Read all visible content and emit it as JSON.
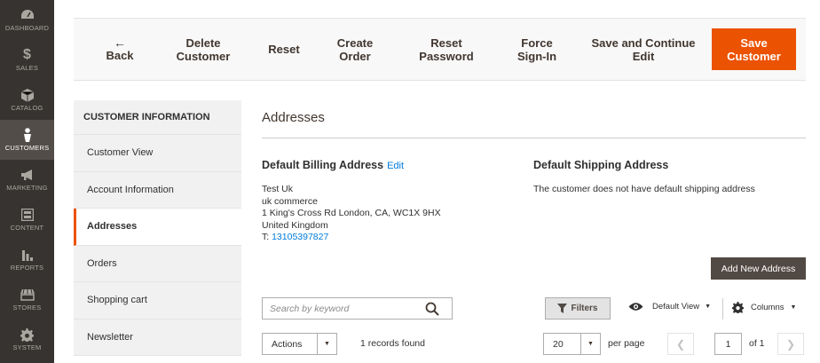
{
  "admin_menu": {
    "items": [
      {
        "label": "DASHBOARD",
        "icon": "dashboard-icon",
        "active": false
      },
      {
        "label": "SALES",
        "icon": "dollar-icon",
        "active": false
      },
      {
        "label": "CATALOG",
        "icon": "cube-icon",
        "active": false
      },
      {
        "label": "CUSTOMERS",
        "icon": "person-icon",
        "active": true
      },
      {
        "label": "MARKETING",
        "icon": "megaphone-icon",
        "active": false
      },
      {
        "label": "CONTENT",
        "icon": "layout-icon",
        "active": false
      },
      {
        "label": "REPORTS",
        "icon": "bar-chart-icon",
        "active": false
      },
      {
        "label": "STORES",
        "icon": "storefront-icon",
        "active": false
      },
      {
        "label": "SYSTEM",
        "icon": "gear-icon",
        "active": false
      }
    ]
  },
  "page_actions": {
    "back": {
      "arrow": "←",
      "label": "Back"
    },
    "delete_customer": {
      "line1": "Delete",
      "line2": "Customer"
    },
    "reset": {
      "label": "Reset"
    },
    "create_order": {
      "line1": "Create",
      "line2": "Order"
    },
    "reset_password": {
      "line1": "Reset",
      "line2": "Password"
    },
    "force_signin": {
      "line1": "Force",
      "line2": "Sign-In"
    },
    "save_continue": {
      "line1": "Save and Continue",
      "line2": "Edit"
    },
    "save_customer": {
      "line1": "Save",
      "line2": "Customer"
    },
    "save_color": "#eb5202"
  },
  "tabs": {
    "title": "CUSTOMER INFORMATION",
    "items": [
      {
        "label": "Customer View",
        "active": false
      },
      {
        "label": "Account Information",
        "active": false
      },
      {
        "label": "Addresses",
        "active": true
      },
      {
        "label": "Orders",
        "active": false
      },
      {
        "label": "Shopping cart",
        "active": false
      },
      {
        "label": "Newsletter",
        "active": false
      }
    ]
  },
  "main": {
    "title": "Addresses",
    "billing": {
      "title": "Default Billing Address",
      "edit_label": "Edit",
      "lines": [
        "Test Uk",
        "uk commerce",
        "1 King's Cross Rd London, CA, WC1X 9HX",
        "United Kingdom"
      ],
      "phone_prefix": "T: ",
      "phone": "13105397827"
    },
    "shipping": {
      "title": "Default Shipping Address",
      "text": "The customer does not have default shipping address"
    },
    "add_new_address": "Add New Address"
  },
  "grid": {
    "search_placeholder": "Search by keyword",
    "filters_label": "Filters",
    "default_view_label": "Default View",
    "columns_label": "Columns",
    "actions_label": "Actions",
    "records_found": "1 records found",
    "per_page_value": "20",
    "per_page_label": "per page",
    "current_page": "1",
    "of_pages": "of 1"
  }
}
